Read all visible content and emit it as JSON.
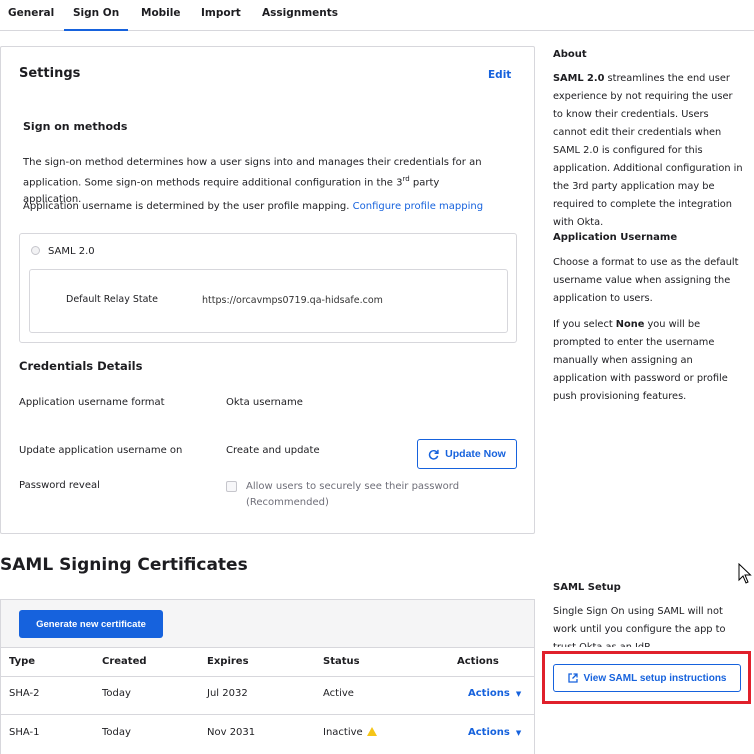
{
  "tabs": [
    "General",
    "Sign On",
    "Mobile",
    "Import",
    "Assignments"
  ],
  "settings": {
    "title": "Settings",
    "edit_label": "Edit",
    "sign_on_methods_title": "Sign on methods",
    "desc_part1": "The sign-on method determines how a user signs into and manages their credentials for an application. Some sign-on methods require additional configuration in the 3",
    "desc_sup": "rd",
    "desc_part2": " party application.",
    "username_text": "Application username is determined by the user profile mapping. ",
    "configure_link": "Configure profile mapping",
    "method_label": "SAML 2.0",
    "relay_label": "Default Relay State",
    "relay_value": "https://orcavmps0719.qa-hidsafe.com"
  },
  "credentials": {
    "title": "Credentials Details",
    "format_label": "Application username format",
    "format_value": "Okta username",
    "update_label": "Update application username on",
    "update_value": "Create and update",
    "update_button": "Update Now",
    "reveal_label": "Password reveal",
    "reveal_checkbox_label": "Allow users to securely see their password (Recommended)"
  },
  "about": {
    "title": "About",
    "p1_bold": "SAML 2.0",
    "p1": " streamlines the end user experience by not requiring the user to know their credentials. Users cannot edit their credentials when SAML 2.0 is configured for this application. Additional configuration in the 3rd party application may be required to complete the integration with Okta.",
    "username_title": "Application Username",
    "p2": "Choose a format to use as the default username value when assigning the application to users.",
    "p3_a": "If you select ",
    "p3_bold": "None",
    "p3_b": " you will be prompted to enter the username manually when assigning an application with password or profile push provisioning features."
  },
  "certs": {
    "title": "SAML Signing Certificates",
    "generate_button": "Generate new certificate",
    "headers": [
      "Type",
      "Created",
      "Expires",
      "Status",
      "Actions"
    ],
    "rows": [
      {
        "type": "SHA-2",
        "created": "Today",
        "expires": "Jul 2032",
        "status": "Active",
        "action": "Actions"
      },
      {
        "type": "SHA-1",
        "created": "Today",
        "expires": "Nov 2031",
        "status": "Inactive",
        "action": "Actions"
      }
    ]
  },
  "saml_setup": {
    "title": "SAML Setup",
    "text": "Single Sign On using SAML will not work until you configure the app to trust Okta as an IdP.",
    "button": "View SAML setup instructions"
  },
  "colors": {
    "accent": "#1662dd",
    "highlight": "#e0202b",
    "warning": "#f5c518"
  }
}
